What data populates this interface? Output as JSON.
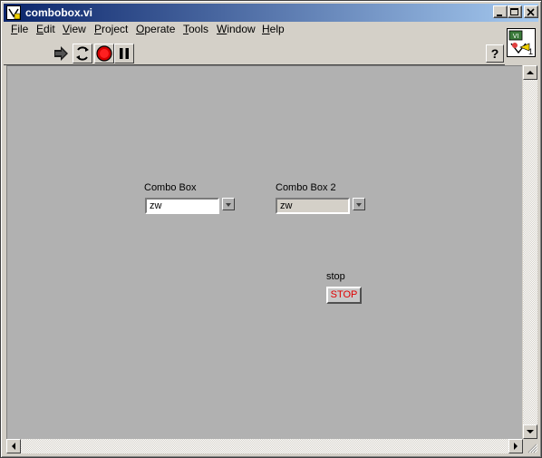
{
  "window": {
    "title": "combobox.vi"
  },
  "menu": [
    {
      "label": "File",
      "underline": "F",
      "rest": "ile"
    },
    {
      "label": "Edit",
      "underline": "E",
      "rest": "dit"
    },
    {
      "label": "View",
      "underline": "V",
      "rest": "iew"
    },
    {
      "label": "Project",
      "underline": "P",
      "rest": "roject"
    },
    {
      "label": "Operate",
      "underline": "O",
      "rest": "perate"
    },
    {
      "label": "Tools",
      "underline": "T",
      "rest": "ools"
    },
    {
      "label": "Window",
      "underline": "W",
      "rest": "indow"
    },
    {
      "label": "Help",
      "underline": "H",
      "rest": "elp"
    }
  ],
  "toolbar": {
    "help_glyph": "?"
  },
  "vi_icon": {
    "number": "1"
  },
  "front_panel": {
    "combo1": {
      "label": "Combo Box",
      "value": "zw"
    },
    "combo2": {
      "label": "Combo Box 2",
      "value": "zw"
    },
    "stop": {
      "label": "stop",
      "button_text": "STOP"
    }
  },
  "colors": {
    "panel_bg": "#b1b1b1",
    "stop_text": "#e00000",
    "combo1_field": "#ffffff",
    "combo2_field": "#d4d0c8"
  }
}
